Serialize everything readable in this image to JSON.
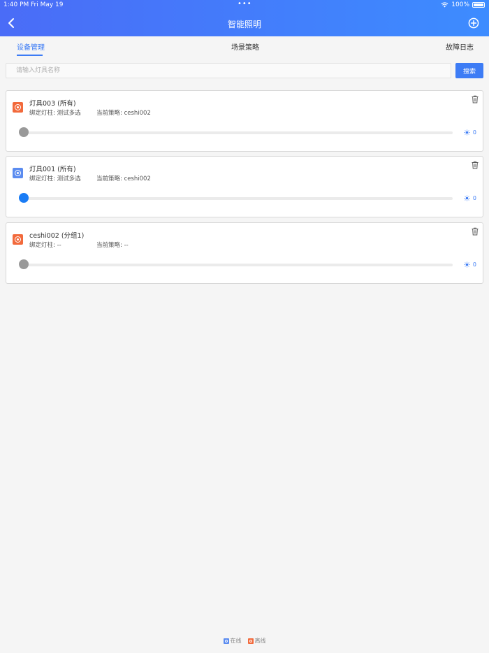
{
  "status_bar": {
    "time": "1:40 PM",
    "date": "Fri May 19",
    "dots": "•••",
    "battery": "100%"
  },
  "header": {
    "title": "智能照明"
  },
  "tabs": [
    {
      "label": "设备管理",
      "active": true
    },
    {
      "label": "场景策略",
      "active": false
    },
    {
      "label": "故障日志",
      "active": false
    }
  ],
  "search": {
    "placeholder": "请输入灯具名称",
    "value": "",
    "button_label": "搜索"
  },
  "devices": [
    {
      "name": "灯具003 (所有)",
      "pole": "绑定灯柱: 测试多选",
      "strategy": "当前策略: ceshi002",
      "status": "offline",
      "brightness": "0"
    },
    {
      "name": "灯具001 (所有)",
      "pole": "绑定灯柱: 测试多选",
      "strategy": "当前策略: ceshi002",
      "status": "online",
      "brightness": "0"
    },
    {
      "name": "ceshi002 (分组1)",
      "pole": "绑定灯柱: --",
      "strategy": "当前策略: --",
      "status": "offline",
      "brightness": "0"
    }
  ],
  "legend": {
    "online": "在线",
    "offline": "离线"
  },
  "colors": {
    "header_start": "#4a6cf7",
    "header_end": "#3d8cff",
    "accent": "#3d7cf5",
    "online": "#5b8cf0",
    "offline": "#f26a3c",
    "thumb_off": "#999999",
    "thumb_on": "#1a7cf5"
  },
  "icons": {
    "back": "chevron-left-icon",
    "add": "plus-circle-icon",
    "delete": "trash-icon",
    "lamp": "lamp-icon",
    "brightness": "sun-icon"
  }
}
